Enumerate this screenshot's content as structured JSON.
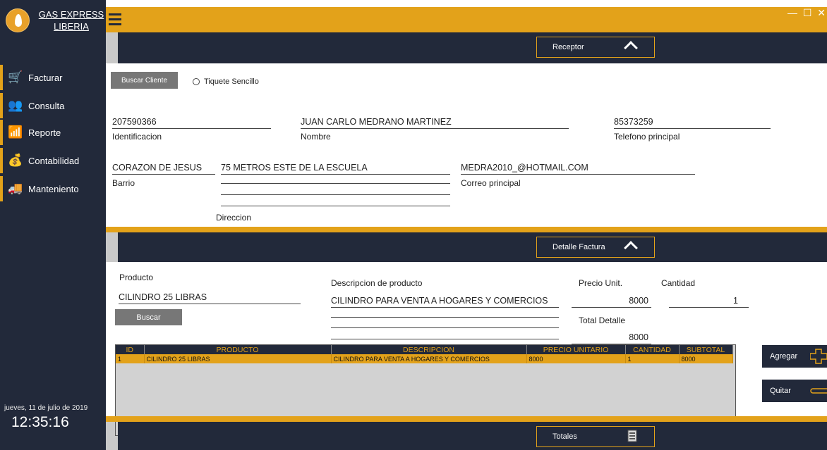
{
  "app": {
    "brand_line1": "GAS EXPRESS",
    "brand_line2": "LIBERIA",
    "window_controls": "— ☐ ✕"
  },
  "sidebar": {
    "items": [
      {
        "label": "Facturar",
        "icon": "cart-icon"
      },
      {
        "label": "Consulta",
        "icon": "users-icon"
      },
      {
        "label": "Reporte",
        "icon": "chart-icon"
      },
      {
        "label": "Contabilidad",
        "icon": "money-bag-icon"
      },
      {
        "label": "Manteniento",
        "icon": "truck-icon"
      }
    ],
    "date": "jueves, 11 de julio de 2019",
    "time": "12:35:16"
  },
  "receptor": {
    "header": "Receptor",
    "buscar_cliente": "Buscar Cliente",
    "tiquete": "Tiquete Sencillo",
    "identificacion": "207590366",
    "identificacion_label": "Identificacion",
    "nombre": "JUAN CARLO MEDRANO MARTINEZ",
    "nombre_label": "Nombre",
    "telefono": "85373259",
    "telefono_label": "Telefono principal",
    "barrio": "CORAZON DE JESUS",
    "barrio_label": "Barrio",
    "direccion": "75 METROS ESTE DE LA ESCUELA",
    "direccion_label": "Direccion",
    "correo": "MEDRA2010_@HOTMAIL.COM",
    "correo_label": "Correo principal"
  },
  "detalle": {
    "header": "Detalle Factura",
    "producto_label": "Producto",
    "producto": "CILINDRO 25 LIBRAS",
    "buscar": "Buscar",
    "descripcion_label": "Descripcion de producto",
    "descripcion": "CILINDRO PARA VENTA A HOGARES Y COMERCIOS",
    "precio_label": "Precio Unit.",
    "precio": "8000",
    "cantidad_label": "Cantidad",
    "cantidad": "1",
    "total_label": "Total Detalle",
    "total": "8000"
  },
  "grid": {
    "columns": [
      "ID",
      "PRODUCTO",
      "DESCRIPCION",
      "PRECIO UNITARIO",
      "CANTIDAD",
      "SUBTOTAL"
    ],
    "rows": [
      [
        "1",
        "CILINDRO 25 LIBRAS",
        "CILINDRO PARA VENTA A HOGARES Y COMERCIOS",
        "8000",
        "1",
        "8000"
      ]
    ]
  },
  "actions": {
    "agregar": "Agregar",
    "quitar": "Quitar"
  },
  "totales": {
    "header": "Totales"
  },
  "colors": {
    "accent": "#e3a21a",
    "dark": "#22293a"
  }
}
